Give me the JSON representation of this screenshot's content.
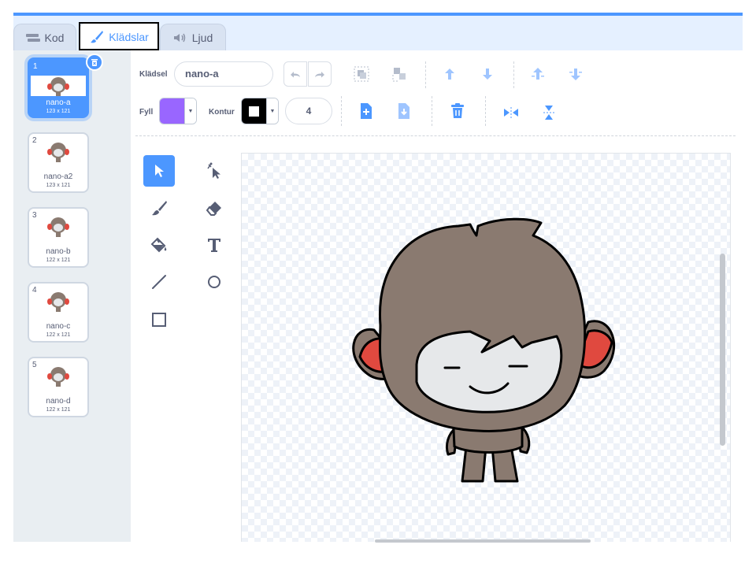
{
  "tabs": {
    "code": "Kod",
    "costumes": "Klädslar",
    "sounds": "Ljud"
  },
  "costumes": [
    {
      "number": "1",
      "name": "nano-a",
      "size": "123 x 121",
      "selected": true
    },
    {
      "number": "2",
      "name": "nano-a2",
      "size": "123 x 121",
      "selected": false
    },
    {
      "number": "3",
      "name": "nano-b",
      "size": "122 x 121",
      "selected": false
    },
    {
      "number": "4",
      "name": "nano-c",
      "size": "122 x 121",
      "selected": false
    },
    {
      "number": "5",
      "name": "nano-d",
      "size": "122 x 121",
      "selected": false
    }
  ],
  "toolbar": {
    "costume_label": "Klädsel",
    "costume_name": "nano-a",
    "fill_label": "Fyll",
    "fill_color": "#9966ff",
    "outline_label": "Kontur",
    "outline_color": "#000000",
    "outline_width": "4"
  },
  "tools": [
    "select",
    "reshape",
    "brush",
    "eraser",
    "fill",
    "text",
    "line",
    "circle",
    "rectangle"
  ],
  "selected_tool": "select",
  "colors": {
    "accent": "#4c97ff",
    "monkey_fur": "#8a7a70",
    "monkey_ear": "#e0493f",
    "face": "#e6e8ea"
  }
}
